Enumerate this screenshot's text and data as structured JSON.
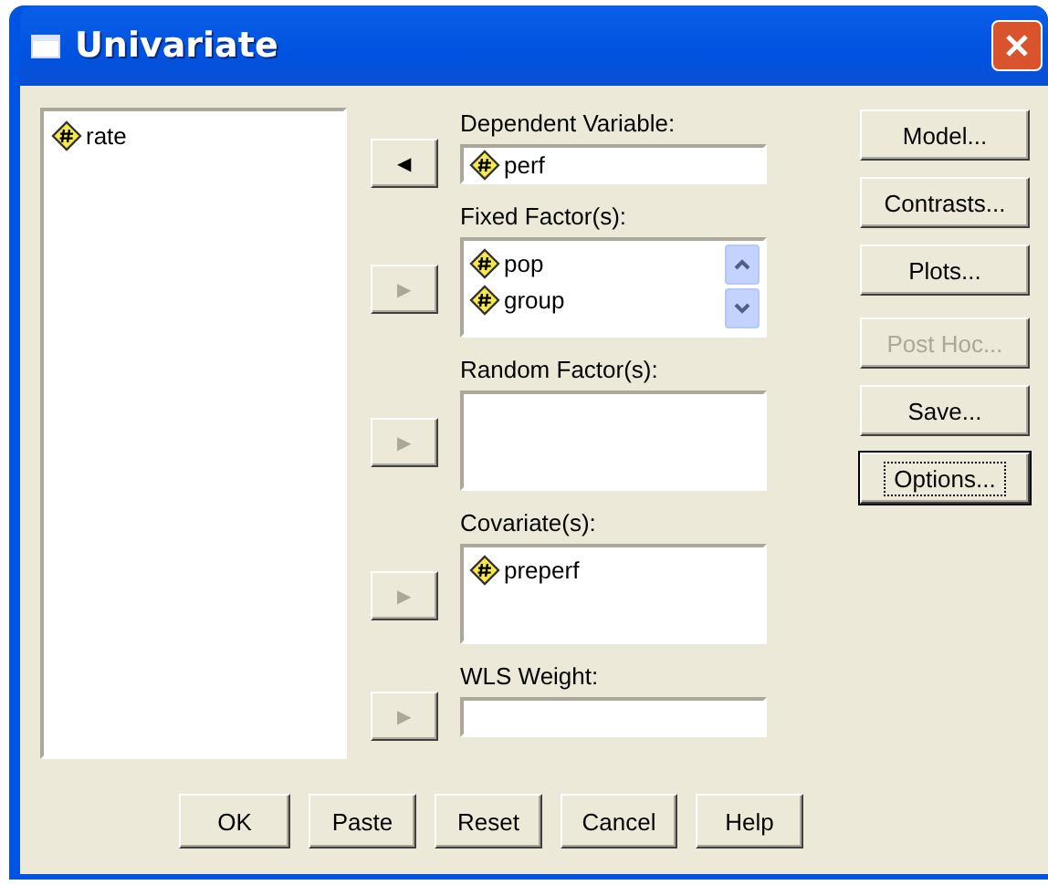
{
  "window": {
    "title": "Univariate"
  },
  "source_variables": [
    {
      "name": "rate"
    }
  ],
  "target_groups": [
    {
      "label": "Dependent Variable:",
      "kind": "field",
      "arrow": "◀",
      "arrow_disabled": false,
      "scrollable": false,
      "variables": [
        "perf"
      ]
    },
    {
      "label": "Fixed Factor(s):",
      "kind": "list",
      "arrow": "▶",
      "arrow_disabled": true,
      "scrollable": true,
      "variables": [
        "pop",
        "group"
      ]
    },
    {
      "label": "Random Factor(s):",
      "kind": "list",
      "arrow": "▶",
      "arrow_disabled": true,
      "scrollable": false
    },
    {
      "label": "Covariate(s):",
      "kind": "list",
      "arrow": "▶",
      "arrow_disabled": true,
      "scrollable": false,
      "variables": [
        "preperf"
      ]
    },
    {
      "label": "WLS Weight:",
      "kind": "field",
      "arrow": "▶",
      "arrow_disabled": true,
      "scrollable": false
    }
  ],
  "side_buttons": [
    {
      "label": "Model...",
      "disabled": false,
      "focused": false
    },
    {
      "label": "Contrasts...",
      "disabled": false,
      "focused": false
    },
    {
      "label": "Plots...",
      "disabled": false,
      "focused": false
    },
    {
      "label": "Post Hoc...",
      "disabled": true,
      "focused": false
    },
    {
      "label": "Save...",
      "disabled": false,
      "focused": false
    },
    {
      "label": "Options...",
      "disabled": false,
      "focused": true
    }
  ],
  "bottom_buttons": [
    "OK",
    "Paste",
    "Reset",
    "Cancel",
    "Help"
  ]
}
